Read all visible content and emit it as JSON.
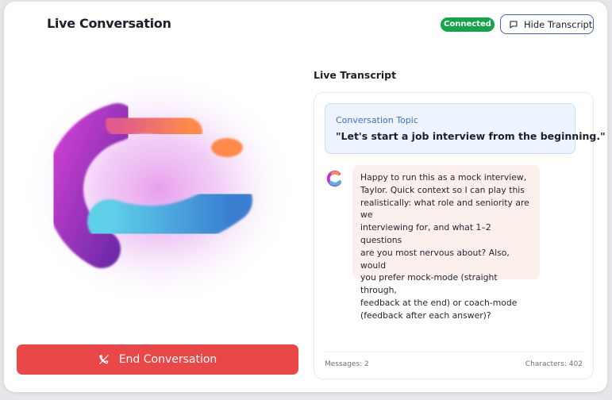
{
  "header": {
    "title": "Live Conversation",
    "status_badge": "Connected",
    "hide_transcript_label": "Hide Transcript"
  },
  "controls": {
    "end_conversation_label": "End Conversation"
  },
  "transcript": {
    "title": "Live Transcript",
    "topic": {
      "label": "Conversation Topic",
      "text": "\"Let's start a job interview from the beginning.\""
    },
    "messages": [
      {
        "sender": "assistant",
        "lines": [
          "Happy to run this as a mock interview,",
          "Taylor. Quick context so I can play this",
          "realistically: what role and seniority are we",
          "interviewing for, and what 1–2 questions",
          "are you most nervous about? Also, would",
          "you prefer mock-mode (straight through,",
          "feedback at the end) or coach-mode",
          "(feedback after each answer)?"
        ]
      }
    ],
    "footer": {
      "messages_count": "Messages: 2",
      "characters_count": "Characters: 402"
    }
  },
  "colors": {
    "connected_green": "#17a34a",
    "end_button_red": "#ea4747",
    "topic_blue": "#3a6fd8",
    "bubble_bg": "#fbf0ec"
  },
  "icons": {
    "hide_transcript": "message-square-icon",
    "end_conversation": "phone-off-icon",
    "assistant_avatar": "logo-ring-icon"
  }
}
